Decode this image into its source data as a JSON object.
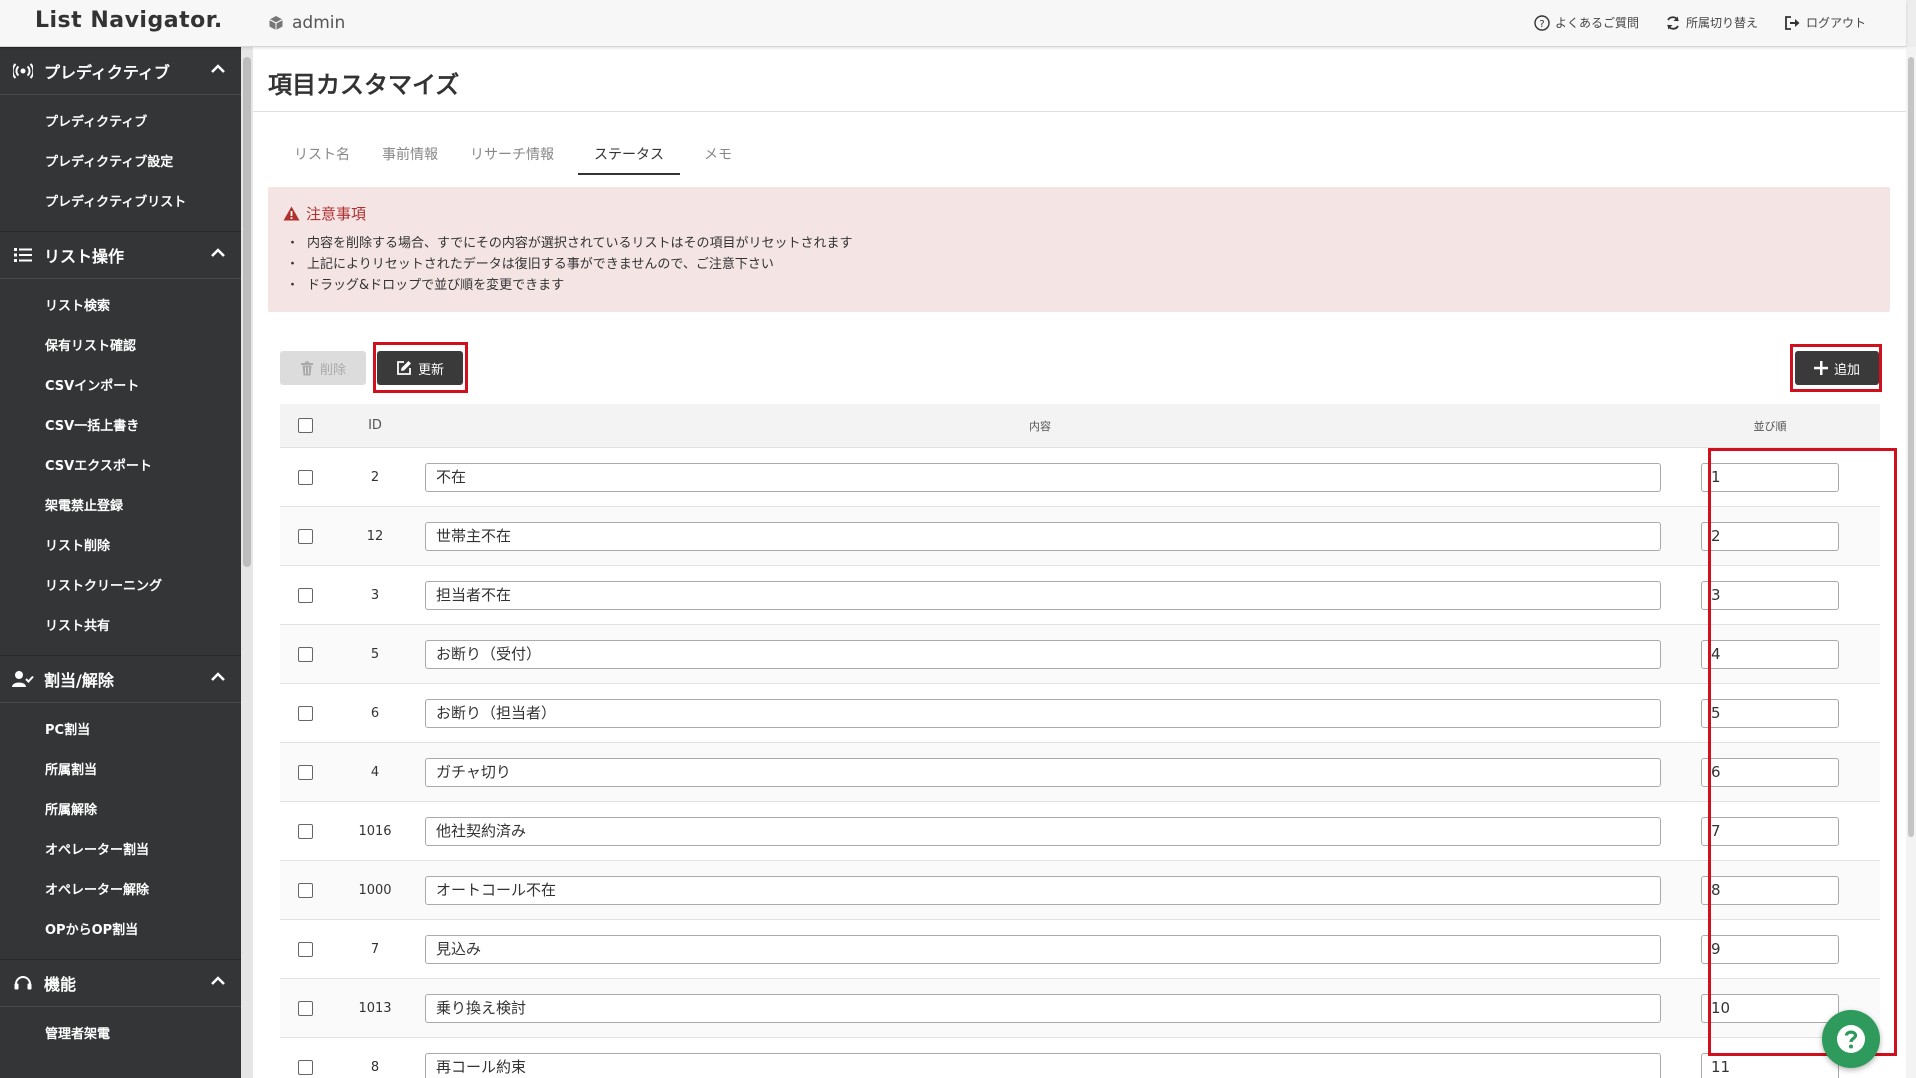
{
  "header": {
    "logo": "List Navigator.",
    "user": "admin",
    "actions": {
      "faq": "よくあるご質問",
      "switch": "所属切り替え",
      "logout": "ログアウト"
    }
  },
  "sidebar": {
    "sections": [
      {
        "title": "プレディクティブ",
        "items": [
          "プレディクティブ",
          "プレディクティブ設定",
          "プレディクティブリスト"
        ]
      },
      {
        "title": "リスト操作",
        "items": [
          "リスト検索",
          "保有リスト確認",
          "CSVインポート",
          "CSV一括上書き",
          "CSVエクスポート",
          "架電禁止登録",
          "リスト削除",
          "リストクリーニング",
          "リスト共有"
        ]
      },
      {
        "title": "割当/解除",
        "items": [
          "PC割当",
          "所属割当",
          "所属解除",
          "オペレーター割当",
          "オペレーター解除",
          "OPからOP割当"
        ]
      },
      {
        "title": "機能",
        "items": [
          "管理者架電"
        ]
      }
    ]
  },
  "page": {
    "title": "項目カスタマイズ",
    "tabs": [
      "リスト名",
      "事前情報",
      "リサーチ情報",
      "ステータス",
      "メモ"
    ],
    "active_tab": "ステータス"
  },
  "notice": {
    "title": "注意事項",
    "lines": [
      "内容を削除する場合、すでにその内容が選択されているリストはその項目がリセットされます",
      "上記によりリセットされたデータは復旧する事ができませんので、ご注意下さい",
      "ドラッグ&ドロップで並び順を変更できます"
    ]
  },
  "toolbar": {
    "delete_label": "削除",
    "update_label": "更新",
    "add_label": "追加"
  },
  "table": {
    "headers": {
      "id": "ID",
      "content": "内容",
      "order": "並び順"
    },
    "rows": [
      {
        "id": "2",
        "content": "不在",
        "order": "1"
      },
      {
        "id": "12",
        "content": "世帯主不在",
        "order": "2"
      },
      {
        "id": "3",
        "content": "担当者不在",
        "order": "3"
      },
      {
        "id": "5",
        "content": "お断り（受付）",
        "order": "4"
      },
      {
        "id": "6",
        "content": "お断り（担当者）",
        "order": "5"
      },
      {
        "id": "4",
        "content": "ガチャ切り",
        "order": "6"
      },
      {
        "id": "1016",
        "content": "他社契約済み",
        "order": "7"
      },
      {
        "id": "1000",
        "content": "オートコール不在",
        "order": "8"
      },
      {
        "id": "7",
        "content": "見込み",
        "order": "9"
      },
      {
        "id": "1013",
        "content": "乗り換え検討",
        "order": "10"
      },
      {
        "id": "8",
        "content": "再コール約束",
        "order": "11"
      }
    ]
  },
  "colors": {
    "sidebar_bg": "#333537",
    "highlight": "#d0101c",
    "notice_bg": "#f4e4e4",
    "notice_title": "#b03030",
    "help_fab": "#2e9a5c"
  }
}
